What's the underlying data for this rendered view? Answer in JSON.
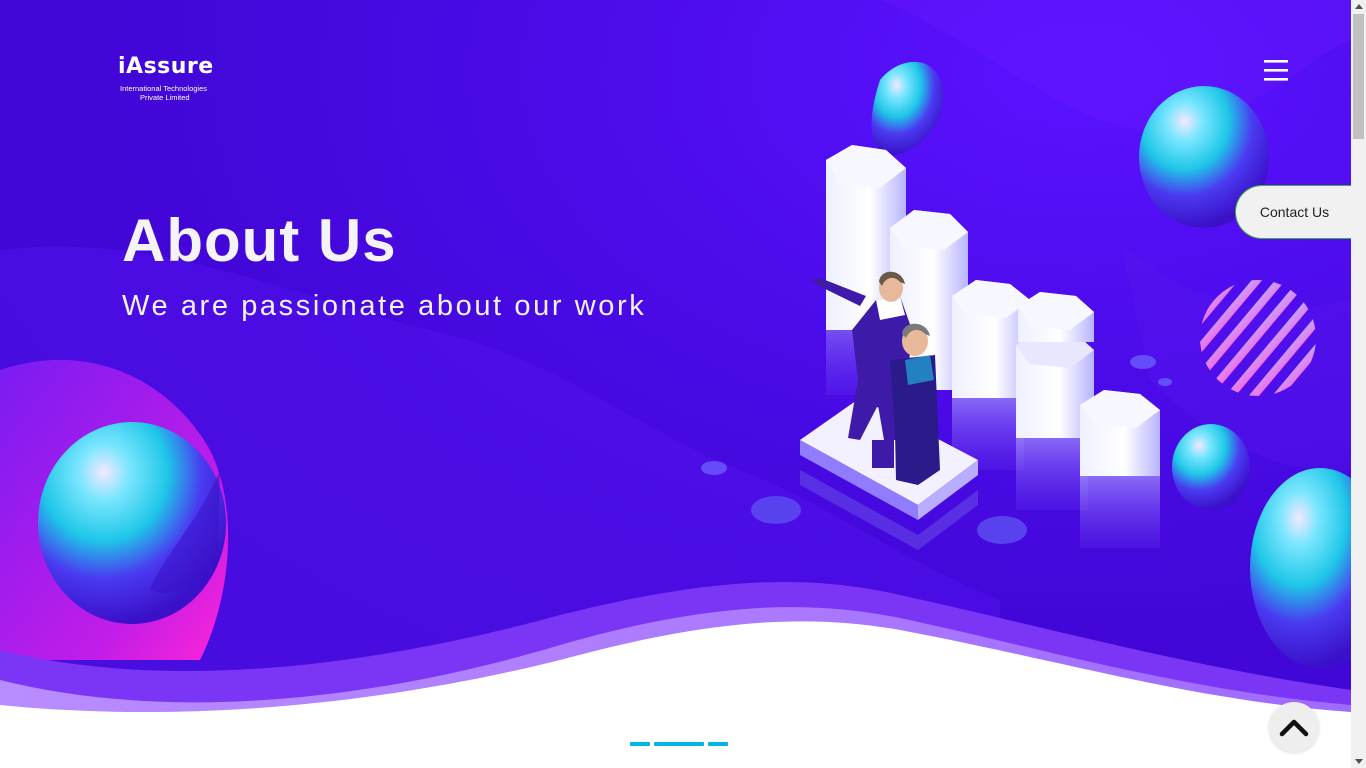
{
  "header": {
    "logo": {
      "word": "iAssure",
      "subtitle_line1": "International Technologies",
      "subtitle_line2": "Private Limited"
    },
    "menu_icon": "hamburger-icon"
  },
  "hero": {
    "title": "About Us",
    "subtitle": "We are passionate about our work"
  },
  "contact_button": {
    "label": "Contact Us"
  },
  "scroll_top": {
    "icon": "chevron-up-icon"
  },
  "carousel": {
    "indicator_count": 3,
    "active_index": 1
  },
  "colors": {
    "hero_background": "#4a0be8",
    "wave_light": "#a77cff",
    "wave_mid": "#7b35f5",
    "indicator": "#00b4e6",
    "contact_border": "#3cb043"
  }
}
